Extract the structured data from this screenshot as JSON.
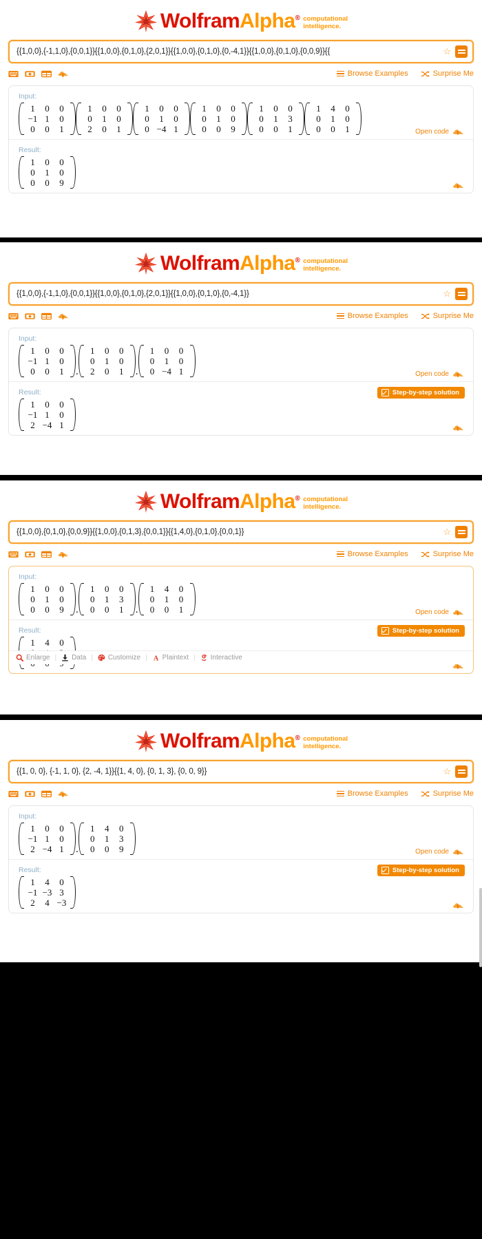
{
  "brand": {
    "name_part1": "Wolfram",
    "name_part2": "Alpha",
    "trademark": "®",
    "tagline_line1": "computational",
    "tagline_line2": "intelligence.",
    "color_red": "#dd1100",
    "color_orange": "#ff9900"
  },
  "toolbar": {
    "icons": [
      "keyboard-icon",
      "camera-icon",
      "table-icon",
      "upload-icon"
    ],
    "browse_examples": "Browse Examples",
    "surprise_me": "Surprise Me"
  },
  "pod_labels": {
    "input": "Input:",
    "result": "Result:",
    "open_code": "Open code",
    "step_by_step": "Step-by-step solution"
  },
  "graphic_bar": {
    "items": [
      {
        "label": "Enlarge",
        "icon": "magnifier-icon"
      },
      {
        "label": "Data",
        "icon": "download-icon"
      },
      {
        "label": "Customize",
        "icon": "palette-icon"
      },
      {
        "label": "Plaintext",
        "icon": "letter-a-icon"
      },
      {
        "label": "Interactive",
        "icon": "spiral-icon"
      }
    ],
    "separator": "|"
  },
  "panels": [
    {
      "id": "panel-1",
      "query": "{{1,0,0},{-1,1,0},{0,0,1}}{{1,0,0},{0,1,0},{2,0,1}}{{1,0,0},{0,1,0},{0,-4,1}}{{1,0,0},{0,1,0},{0,0,9}}{{",
      "input_matrices": [
        [
          [
            "1",
            "0",
            "0"
          ],
          [
            "−1",
            "1",
            "0"
          ],
          [
            "0",
            "0",
            "1"
          ]
        ],
        [
          [
            "1",
            "0",
            "0"
          ],
          [
            "0",
            "1",
            "0"
          ],
          [
            "2",
            "0",
            "1"
          ]
        ],
        [
          [
            "1",
            "0",
            "0"
          ],
          [
            "0",
            "1",
            "0"
          ],
          [
            "0",
            "−4",
            "1"
          ]
        ],
        [
          [
            "1",
            "0",
            "0"
          ],
          [
            "0",
            "1",
            "0"
          ],
          [
            "0",
            "0",
            "9"
          ]
        ],
        [
          [
            "1",
            "0",
            "0"
          ],
          [
            "0",
            "1",
            "3"
          ],
          [
            "0",
            "0",
            "1"
          ]
        ],
        [
          [
            "1",
            "4",
            "0"
          ],
          [
            "0",
            "1",
            "0"
          ],
          [
            "0",
            "0",
            "1"
          ]
        ]
      ],
      "input_separator": "",
      "result_matrix": [
        [
          "1",
          "0",
          "0"
        ],
        [
          "0",
          "1",
          "0"
        ],
        [
          "0",
          "0",
          "9"
        ]
      ],
      "has_step_by_step": false,
      "has_graphic_bar": false
    },
    {
      "id": "panel-2",
      "query": "{{1,0,0},{-1,1,0},{0,0,1}}{{1,0,0},{0,1,0},{2,0,1}}{{1,0,0},{0,1,0},{0,-4,1}}",
      "input_matrices": [
        [
          [
            "1",
            "0",
            "0"
          ],
          [
            "−1",
            "1",
            "0"
          ],
          [
            "0",
            "0",
            "1"
          ]
        ],
        [
          [
            "1",
            "0",
            "0"
          ],
          [
            "0",
            "1",
            "0"
          ],
          [
            "2",
            "0",
            "1"
          ]
        ],
        [
          [
            "1",
            "0",
            "0"
          ],
          [
            "0",
            "1",
            "0"
          ],
          [
            "0",
            "−4",
            "1"
          ]
        ]
      ],
      "input_separator": ".",
      "result_matrix": [
        [
          "1",
          "0",
          "0"
        ],
        [
          "−1",
          "1",
          "0"
        ],
        [
          "2",
          "−4",
          "1"
        ]
      ],
      "has_step_by_step": true,
      "has_graphic_bar": false
    },
    {
      "id": "panel-3",
      "query": "{{1,0,0},{0,1,0},{0,0,9}}{{1,0,0},{0,1,3},{0,0,1}}{{1,4,0},{0,1,0},{0,0,1}}",
      "input_matrices": [
        [
          [
            "1",
            "0",
            "0"
          ],
          [
            "0",
            "1",
            "0"
          ],
          [
            "0",
            "0",
            "9"
          ]
        ],
        [
          [
            "1",
            "0",
            "0"
          ],
          [
            "0",
            "1",
            "3"
          ],
          [
            "0",
            "0",
            "1"
          ]
        ],
        [
          [
            "1",
            "4",
            "0"
          ],
          [
            "0",
            "1",
            "0"
          ],
          [
            "0",
            "0",
            "1"
          ]
        ]
      ],
      "input_separator": ".",
      "result_matrix": [
        [
          "1",
          "4",
          "0"
        ],
        [
          "0",
          "1",
          "3"
        ],
        [
          "0",
          "0",
          "9"
        ]
      ],
      "has_step_by_step": true,
      "has_graphic_bar": true
    },
    {
      "id": "panel-4",
      "query": "{{1, 0, 0}, {-1, 1, 0}, {2, -4, 1}}{{1, 4, 0}, {0, 1, 3}, {0, 0, 9}}",
      "input_matrices": [
        [
          [
            "1",
            "0",
            "0"
          ],
          [
            "−1",
            "1",
            "0"
          ],
          [
            "2",
            "−4",
            "1"
          ]
        ],
        [
          [
            "1",
            "4",
            "0"
          ],
          [
            "0",
            "1",
            "3"
          ],
          [
            "0",
            "0",
            "9"
          ]
        ]
      ],
      "input_separator": ".",
      "result_matrix": [
        [
          "1",
          "4",
          "0"
        ],
        [
          "−1",
          "−3",
          "3"
        ],
        [
          "2",
          "4",
          "−3"
        ]
      ],
      "has_step_by_step": true,
      "has_graphic_bar": false
    }
  ]
}
